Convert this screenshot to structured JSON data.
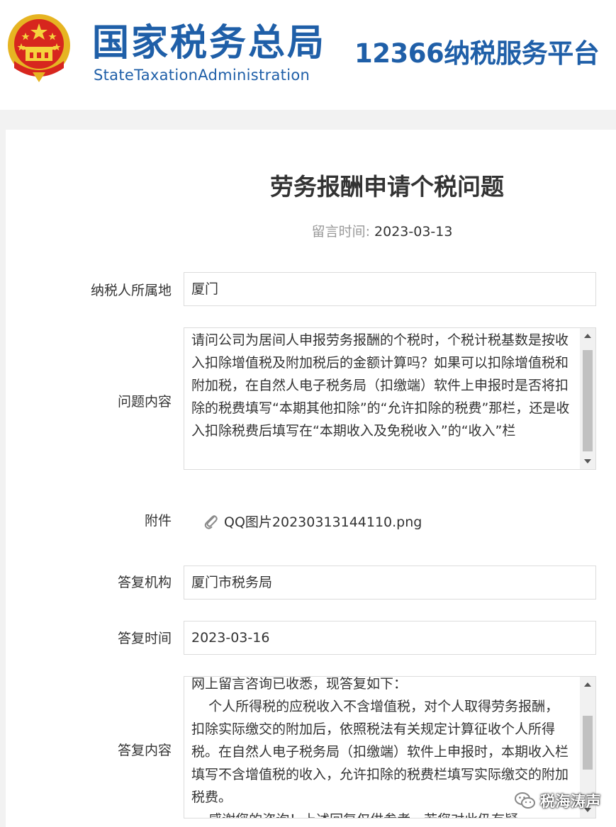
{
  "header": {
    "brand_cn": "国家税务总局",
    "brand_en": "StateTaxationAdministration",
    "platform": "12366纳税服务平台",
    "emblem_icon": "national-emblem-icon",
    "brand_color": "#1f5fa8"
  },
  "article": {
    "title": "劳务报酬申请个税问题",
    "time_label": "留言时间:",
    "time_value": "2023-03-13"
  },
  "form": {
    "region_label": "纳税人所属地",
    "region_value": "厦门",
    "question_label": "问题内容",
    "question_text": "请问公司为居间人申报劳务报酬的个税时，个税计税基数是按收入扣除增值税及附加税后的金额计算吗？如果可以扣除增值税和附加税，在自然人电子税务局（扣缴端）软件上申报时是否将扣除的税费填写“本期其他扣除”的“允许扣除的税费”那栏，还是收入扣除税费后填写在“本期收入及免税收入”的“收入”栏",
    "attachment_label": "附件",
    "attachment_name": "QQ图片20230313144110.png",
    "attachment_icon": "paperclip-icon",
    "org_label": "答复机构",
    "org_value": "厦门市税务局",
    "reply_time_label": "答复时间",
    "reply_time_value": "2023-03-16",
    "reply_label": "答复内容",
    "reply_text": "网上留言咨询已收悉，现答复如下：\n    个人所得税的应税收入不含增值税，对个人取得劳务报酬，扣除实际缴交的附加后，依照税法有关规定计算征收个人所得税。在自然人电子税务局（扣缴端）软件上申报时，本期收入栏填写不含增值税的收入，允许扣除的税费栏填写实际缴交的附加税费。\n    感谢您的咨询！上述回复仅供参考，若您对此仍有疑"
  },
  "watermark": {
    "text": "税海涛声",
    "icon": "wechat-icon"
  }
}
